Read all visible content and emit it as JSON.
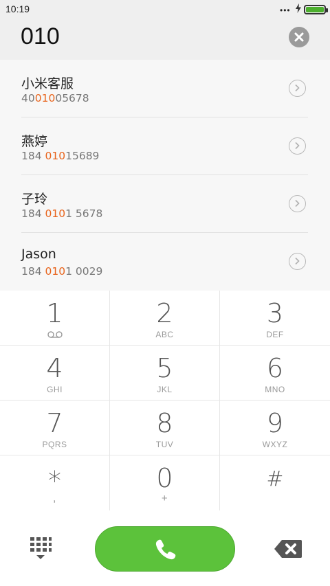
{
  "status_bar": {
    "time": "10:19",
    "dots": "•••",
    "battery_level": 1.0,
    "battery_color": "#4caf2e"
  },
  "dialer": {
    "dialed_number": "010"
  },
  "results": [
    {
      "name": "小米客服",
      "number_pre": "40",
      "number_match": "010",
      "number_post": "05678"
    },
    {
      "name": "燕婷",
      "number_pre": "184 ",
      "number_match": "010",
      "number_post": "15689"
    },
    {
      "name": "子玲",
      "number_pre": "184 ",
      "number_match": "010",
      "number_post": "1 5678"
    },
    {
      "name": "Jason",
      "number_pre": "184 ",
      "number_match": "010",
      "number_post": "1 0029"
    }
  ],
  "keypad": [
    {
      "digit": "1",
      "sub": ""
    },
    {
      "digit": "2",
      "sub": "ABC"
    },
    {
      "digit": "3",
      "sub": "DEF"
    },
    {
      "digit": "4",
      "sub": "GHI"
    },
    {
      "digit": "5",
      "sub": "JKL"
    },
    {
      "digit": "6",
      "sub": "MNO"
    },
    {
      "digit": "7",
      "sub": "PQRS"
    },
    {
      "digit": "8",
      "sub": "TUV"
    },
    {
      "digit": "9",
      "sub": "WXYZ"
    },
    {
      "digit": "*",
      "sub": ","
    },
    {
      "digit": "0",
      "sub": "+"
    },
    {
      "digit": "#",
      "sub": ""
    }
  ],
  "colors": {
    "highlight": "#e8641c",
    "call_green": "#5cc23b"
  },
  "icons": {
    "voicemail": "voicemail-icon",
    "clear": "clear-icon",
    "detail": "chevron-right-icon",
    "dialpad": "dialpad-icon",
    "call": "phone-icon",
    "backspace": "backspace-icon"
  }
}
